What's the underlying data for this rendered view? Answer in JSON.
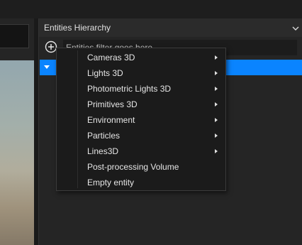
{
  "hierarchy": {
    "title": "Entities Hierarchy",
    "filter_placeholder": "Entities filter goes here"
  },
  "context_menu": {
    "items": [
      {
        "label": "Cameras 3D",
        "has_submenu": true
      },
      {
        "label": "Lights 3D",
        "has_submenu": true
      },
      {
        "label": "Photometric Lights 3D",
        "has_submenu": true
      },
      {
        "label": "Primitives 3D",
        "has_submenu": true
      },
      {
        "label": "Environment",
        "has_submenu": true
      },
      {
        "label": "Particles",
        "has_submenu": true
      },
      {
        "label": "Lines3D",
        "has_submenu": true
      },
      {
        "label": "Post-processing Volume",
        "has_submenu": false
      },
      {
        "label": "Empty entity",
        "has_submenu": false
      }
    ]
  },
  "colors": {
    "selection": "#0a84ff",
    "panel_bg": "#252525",
    "menu_bg": "#1b1b1b"
  },
  "icons": {
    "add": "plus-circle-icon",
    "collapse": "chevron-down-icon",
    "expand": "triangle-down-icon",
    "submenu": "triangle-right-icon"
  }
}
